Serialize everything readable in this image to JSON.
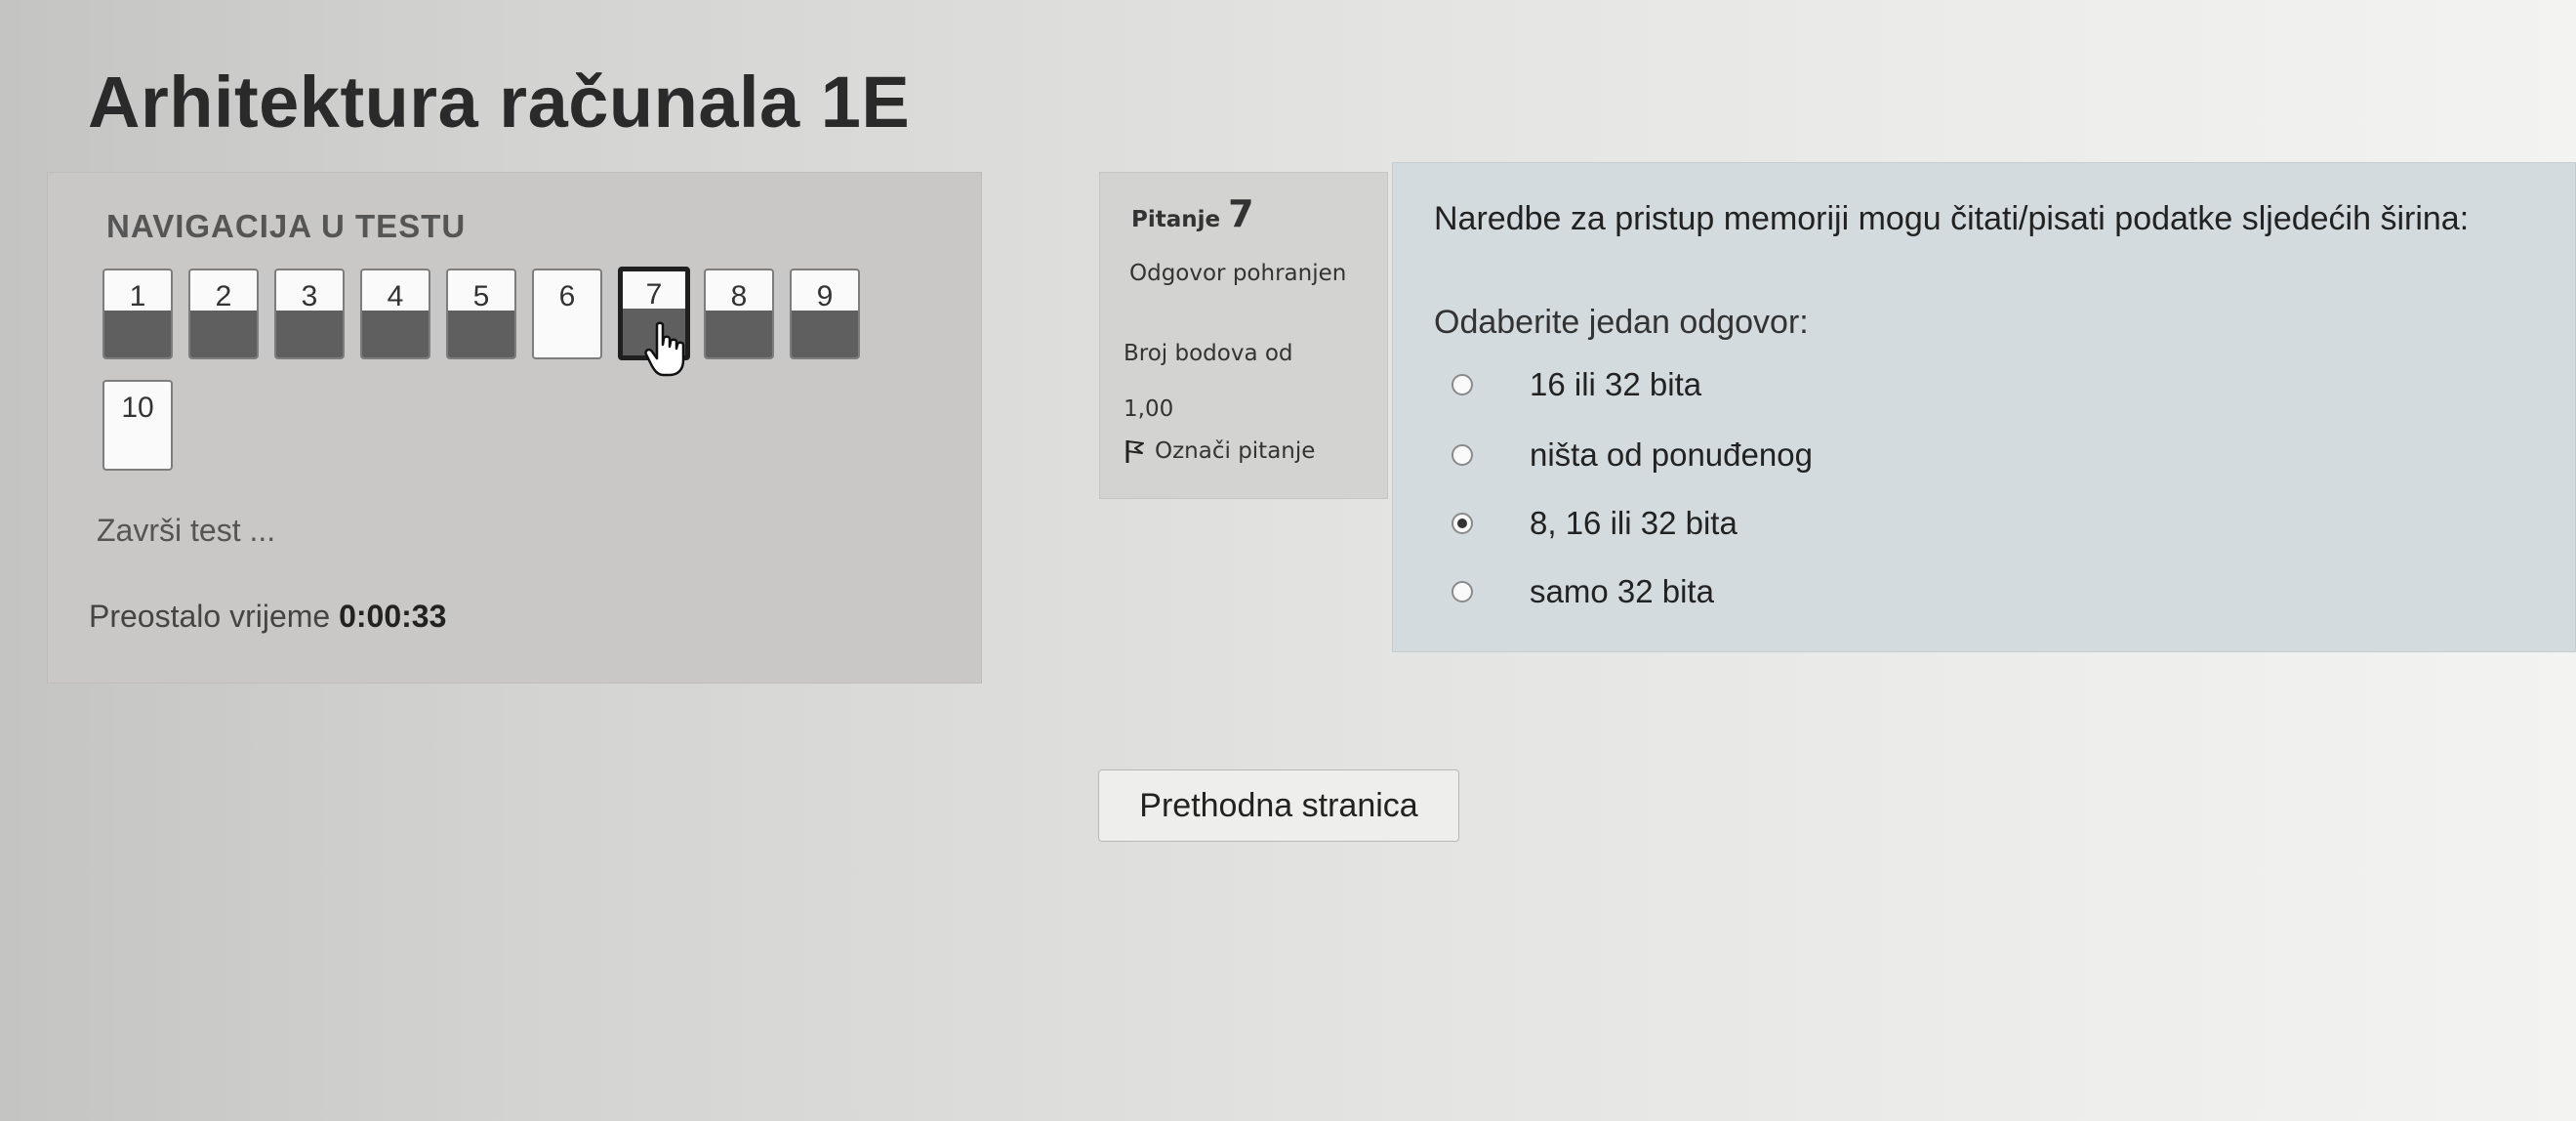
{
  "page_title": "Arhitektura računala 1E",
  "navigation": {
    "heading": "NAVIGACIJA U TESTU",
    "questions": [
      {
        "label": "1",
        "answered": true
      },
      {
        "label": "2",
        "answered": true
      },
      {
        "label": "3",
        "answered": true
      },
      {
        "label": "4",
        "answered": true
      },
      {
        "label": "5",
        "answered": true
      },
      {
        "label": "6",
        "answered": false
      },
      {
        "label": "7",
        "answered": true,
        "current": true
      },
      {
        "label": "8",
        "answered": true
      },
      {
        "label": "9",
        "answered": true
      },
      {
        "label": "10",
        "answered": false
      }
    ],
    "finish_link": "Završi test ...",
    "timer_label": "Preostalo vrijeme",
    "timer_value": "0:00:33"
  },
  "question_info": {
    "label": "Pitanje",
    "number": "7",
    "status": "Odgovor pohranjen",
    "grade_label": "Broj bodova od",
    "grade_value": "1,00",
    "flag_label": "Označi pitanje",
    "flag_icon": "flag-icon"
  },
  "question": {
    "text": "Naredbe za pristup memoriji mogu čitati/pisati podatke sljedećih širina:",
    "prompt": "Odaberite jedan odgovor:",
    "options": [
      {
        "label": "16 ili 32 bita",
        "selected": false
      },
      {
        "label": "ništa od ponuđenog",
        "selected": false
      },
      {
        "label": "8, 16 ili 32 bita",
        "selected": true
      },
      {
        "label": "samo 32 bita",
        "selected": false
      }
    ]
  },
  "buttons": {
    "previous_page": "Prethodna stranica"
  },
  "colors": {
    "answered_fill": "#5e5f5e",
    "question_panel": "#d4dbde",
    "nav_panel": "#c9c8c6"
  }
}
